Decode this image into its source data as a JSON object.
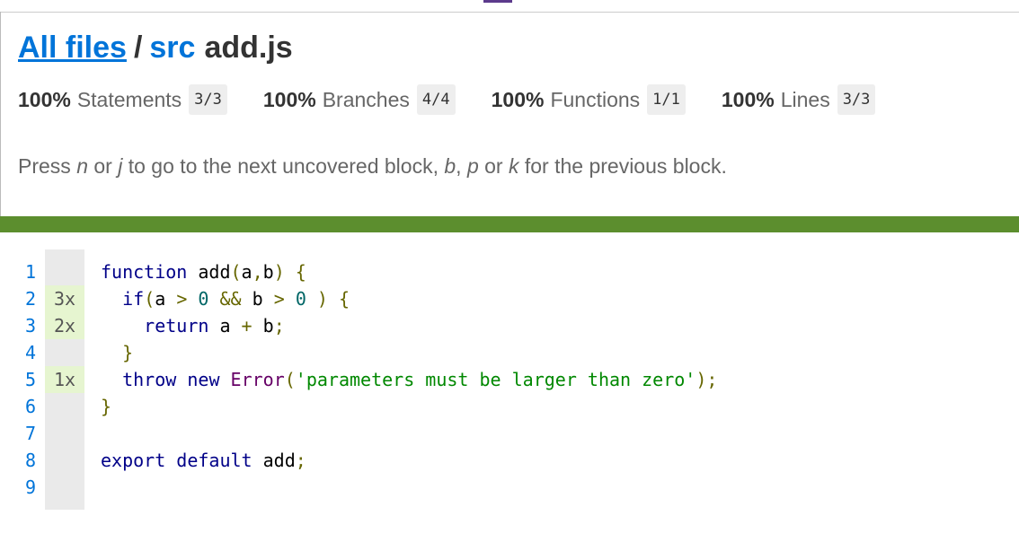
{
  "breadcrumb": {
    "all_files": "All files",
    "separator": "/",
    "folder": "src",
    "file": "add.js"
  },
  "stats": [
    {
      "pct": "100%",
      "label": "Statements",
      "fraction": "3/3"
    },
    {
      "pct": "100%",
      "label": "Branches",
      "fraction": "4/4"
    },
    {
      "pct": "100%",
      "label": "Functions",
      "fraction": "1/1"
    },
    {
      "pct": "100%",
      "label": "Lines",
      "fraction": "3/3"
    }
  ],
  "hint": {
    "t1": "Press ",
    "k1": "n",
    "t2": " or ",
    "k2": "j",
    "t3": " to go to the next uncovered block, ",
    "k3": "b",
    "t4": ", ",
    "k4": "p",
    "t5": " or ",
    "k5": "k",
    "t6": " for the previous block."
  },
  "colors": {
    "status_bar": "#5c8e2e",
    "link": "#0074d9",
    "covered_count_bg": "#e6f5d0"
  },
  "code": {
    "line_numbers": [
      "1",
      "2",
      "3",
      "4",
      "5",
      "6",
      "7",
      "8",
      "9"
    ],
    "counts": [
      "",
      "3x",
      "2x",
      "",
      "1x",
      "",
      "",
      "",
      ""
    ],
    "lines": [
      [
        {
          "c": "kw",
          "t": "function"
        },
        {
          "c": "pln",
          "t": " add"
        },
        {
          "c": "pun",
          "t": "("
        },
        {
          "c": "pln",
          "t": "a"
        },
        {
          "c": "pun",
          "t": ","
        },
        {
          "c": "pln",
          "t": "b"
        },
        {
          "c": "pun",
          "t": ")"
        },
        {
          "c": "pln",
          "t": " "
        },
        {
          "c": "pun",
          "t": "{"
        }
      ],
      [
        {
          "c": "pln",
          "t": "  "
        },
        {
          "c": "kw",
          "t": "if"
        },
        {
          "c": "pun",
          "t": "("
        },
        {
          "c": "pln",
          "t": "a "
        },
        {
          "c": "pun",
          "t": ">"
        },
        {
          "c": "pln",
          "t": " "
        },
        {
          "c": "lit",
          "t": "0"
        },
        {
          "c": "pln",
          "t": " "
        },
        {
          "c": "pun",
          "t": "&&"
        },
        {
          "c": "pln",
          "t": " b "
        },
        {
          "c": "pun",
          "t": ">"
        },
        {
          "c": "pln",
          "t": " "
        },
        {
          "c": "lit",
          "t": "0"
        },
        {
          "c": "pln",
          "t": " "
        },
        {
          "c": "pun",
          "t": ")"
        },
        {
          "c": "pln",
          "t": " "
        },
        {
          "c": "pun",
          "t": "{"
        }
      ],
      [
        {
          "c": "pln",
          "t": "    "
        },
        {
          "c": "kw",
          "t": "return"
        },
        {
          "c": "pln",
          "t": " a "
        },
        {
          "c": "pun",
          "t": "+"
        },
        {
          "c": "pln",
          "t": " b"
        },
        {
          "c": "pun",
          "t": ";"
        }
      ],
      [
        {
          "c": "pln",
          "t": "  "
        },
        {
          "c": "pun",
          "t": "}"
        }
      ],
      [
        {
          "c": "pln",
          "t": "  "
        },
        {
          "c": "kw",
          "t": "throw"
        },
        {
          "c": "pln",
          "t": " "
        },
        {
          "c": "kw",
          "t": "new"
        },
        {
          "c": "pln",
          "t": " "
        },
        {
          "c": "typ",
          "t": "Error"
        },
        {
          "c": "pun",
          "t": "("
        },
        {
          "c": "str",
          "t": "'parameters must be larger than zero'"
        },
        {
          "c": "pun",
          "t": ");"
        }
      ],
      [
        {
          "c": "pun",
          "t": "}"
        }
      ],
      [],
      [
        {
          "c": "kw",
          "t": "export"
        },
        {
          "c": "pln",
          "t": " "
        },
        {
          "c": "kw",
          "t": "default"
        },
        {
          "c": "pln",
          "t": " add"
        },
        {
          "c": "pun",
          "t": ";"
        }
      ],
      []
    ]
  }
}
